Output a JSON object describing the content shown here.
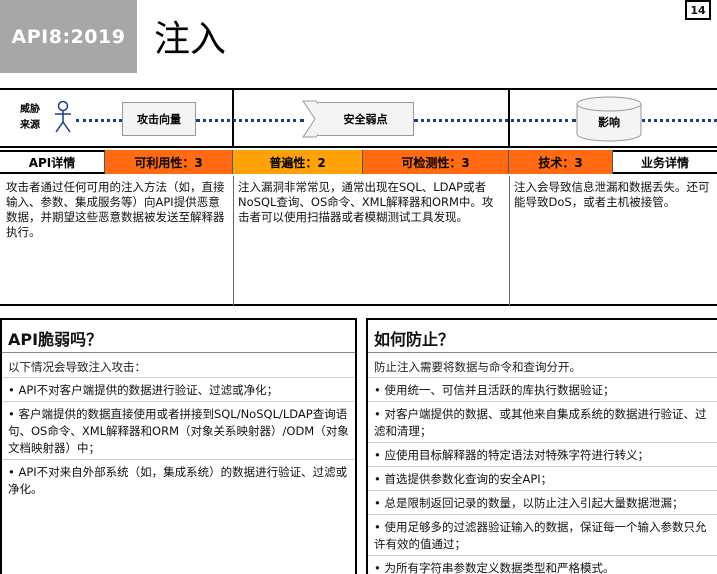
{
  "header": {
    "badge": "API8:2019",
    "title": "注入",
    "page_number": "14"
  },
  "flow": {
    "threat_agent_line1": "威胁",
    "threat_agent_line2": "来源",
    "attack_vector": "攻击向量",
    "security_weakness": "安全弱点",
    "impact": "影响",
    "accent_color": "#1e3a8a"
  },
  "ratings": {
    "api_details": "API详情",
    "exploitability": "可利用性：3",
    "prevalence": "普遍性：2",
    "detectability": "可检测性：3",
    "technical": "技术：3",
    "business_details": "业务详情"
  },
  "descriptions": {
    "attack": "攻击者通过任何可用的注入方法（如，直接输入、参数、集成服务等）向API提供恶意数据，并期望这些恶意数据被发送至解释器执行。",
    "weakness": "注入漏洞非常常见，通常出现在SQL、LDAP或者NoSQL查询、OS命令、XML解释器和ORM中。攻击者可以使用扫描器或者模糊测试工具发现。",
    "impact": "注入会导致信息泄漏和数据丢失。还可能导致DoS，或者主机被接管。"
  },
  "vulnerable": {
    "heading": "API脆弱吗？",
    "intro": "以下情况会导致注入攻击：",
    "items": [
      "API不对客户端提供的数据进行验证、过滤或净化；",
      "客户端提供的数据直接使用或者拼接到SQL/NoSQL/LDAP查询语句、OS命令、XML解释器和ORM（对象关系映射器）/ODM（对象文档映射器）中；",
      "API不对来自外部系统（如，集成系统）的数据进行验证、过滤或净化。"
    ]
  },
  "prevent": {
    "heading": "如何防止？",
    "intro": "防止注入需要将数据与命令和查询分开。",
    "items": [
      "使用统一、可信并且活跃的库执行数据验证；",
      "对客户端提供的数据、或其他来自集成系统的数据进行验证、过滤和清理；",
      "应使用目标解释器的特定语法对特殊字符进行转义；",
      "首选提供参数化查询的安全API；",
      "总是限制返回记录的数量，以防止注入引起大量数据泄漏；",
      "使用足够多的过滤器验证输入的数据，保证每一个输入参数只允许有效的值通过；",
      "为所有字符串参数定义数据类型和严格模式。"
    ]
  }
}
